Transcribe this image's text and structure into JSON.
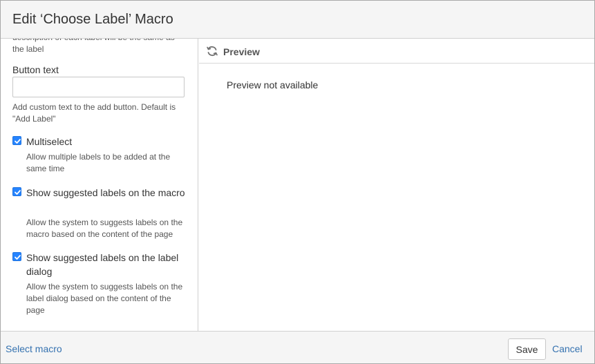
{
  "dialog": {
    "title": "Edit ‘Choose Label’ Macro"
  },
  "left_panel": {
    "cut_description": "description of each label will be the same as the label",
    "button_text": {
      "label": "Button text",
      "value": "",
      "placeholder": "",
      "help": "Add custom text to the add button. Default is \"Add Label\""
    },
    "options": [
      {
        "label": "Multiselect",
        "checked": true,
        "help": "Allow multiple labels to be added at the same time"
      },
      {
        "label": "Show suggested labels on the macro",
        "checked": true,
        "help": "Allow the system to suggests labels on the macro based on the content of the page"
      },
      {
        "label": "Show suggested labels on the label dialog",
        "checked": true,
        "help": "Allow the system to suggests labels on the label dialog based on the content of the page"
      }
    ]
  },
  "preview": {
    "title": "Preview",
    "icon": "refresh-icon",
    "message": "Preview not available"
  },
  "footer": {
    "select_macro": "Select macro",
    "save": "Save",
    "cancel": "Cancel"
  },
  "colors": {
    "accent": "#2684ff",
    "link": "#3572b0",
    "header_bg": "#f5f5f5"
  }
}
